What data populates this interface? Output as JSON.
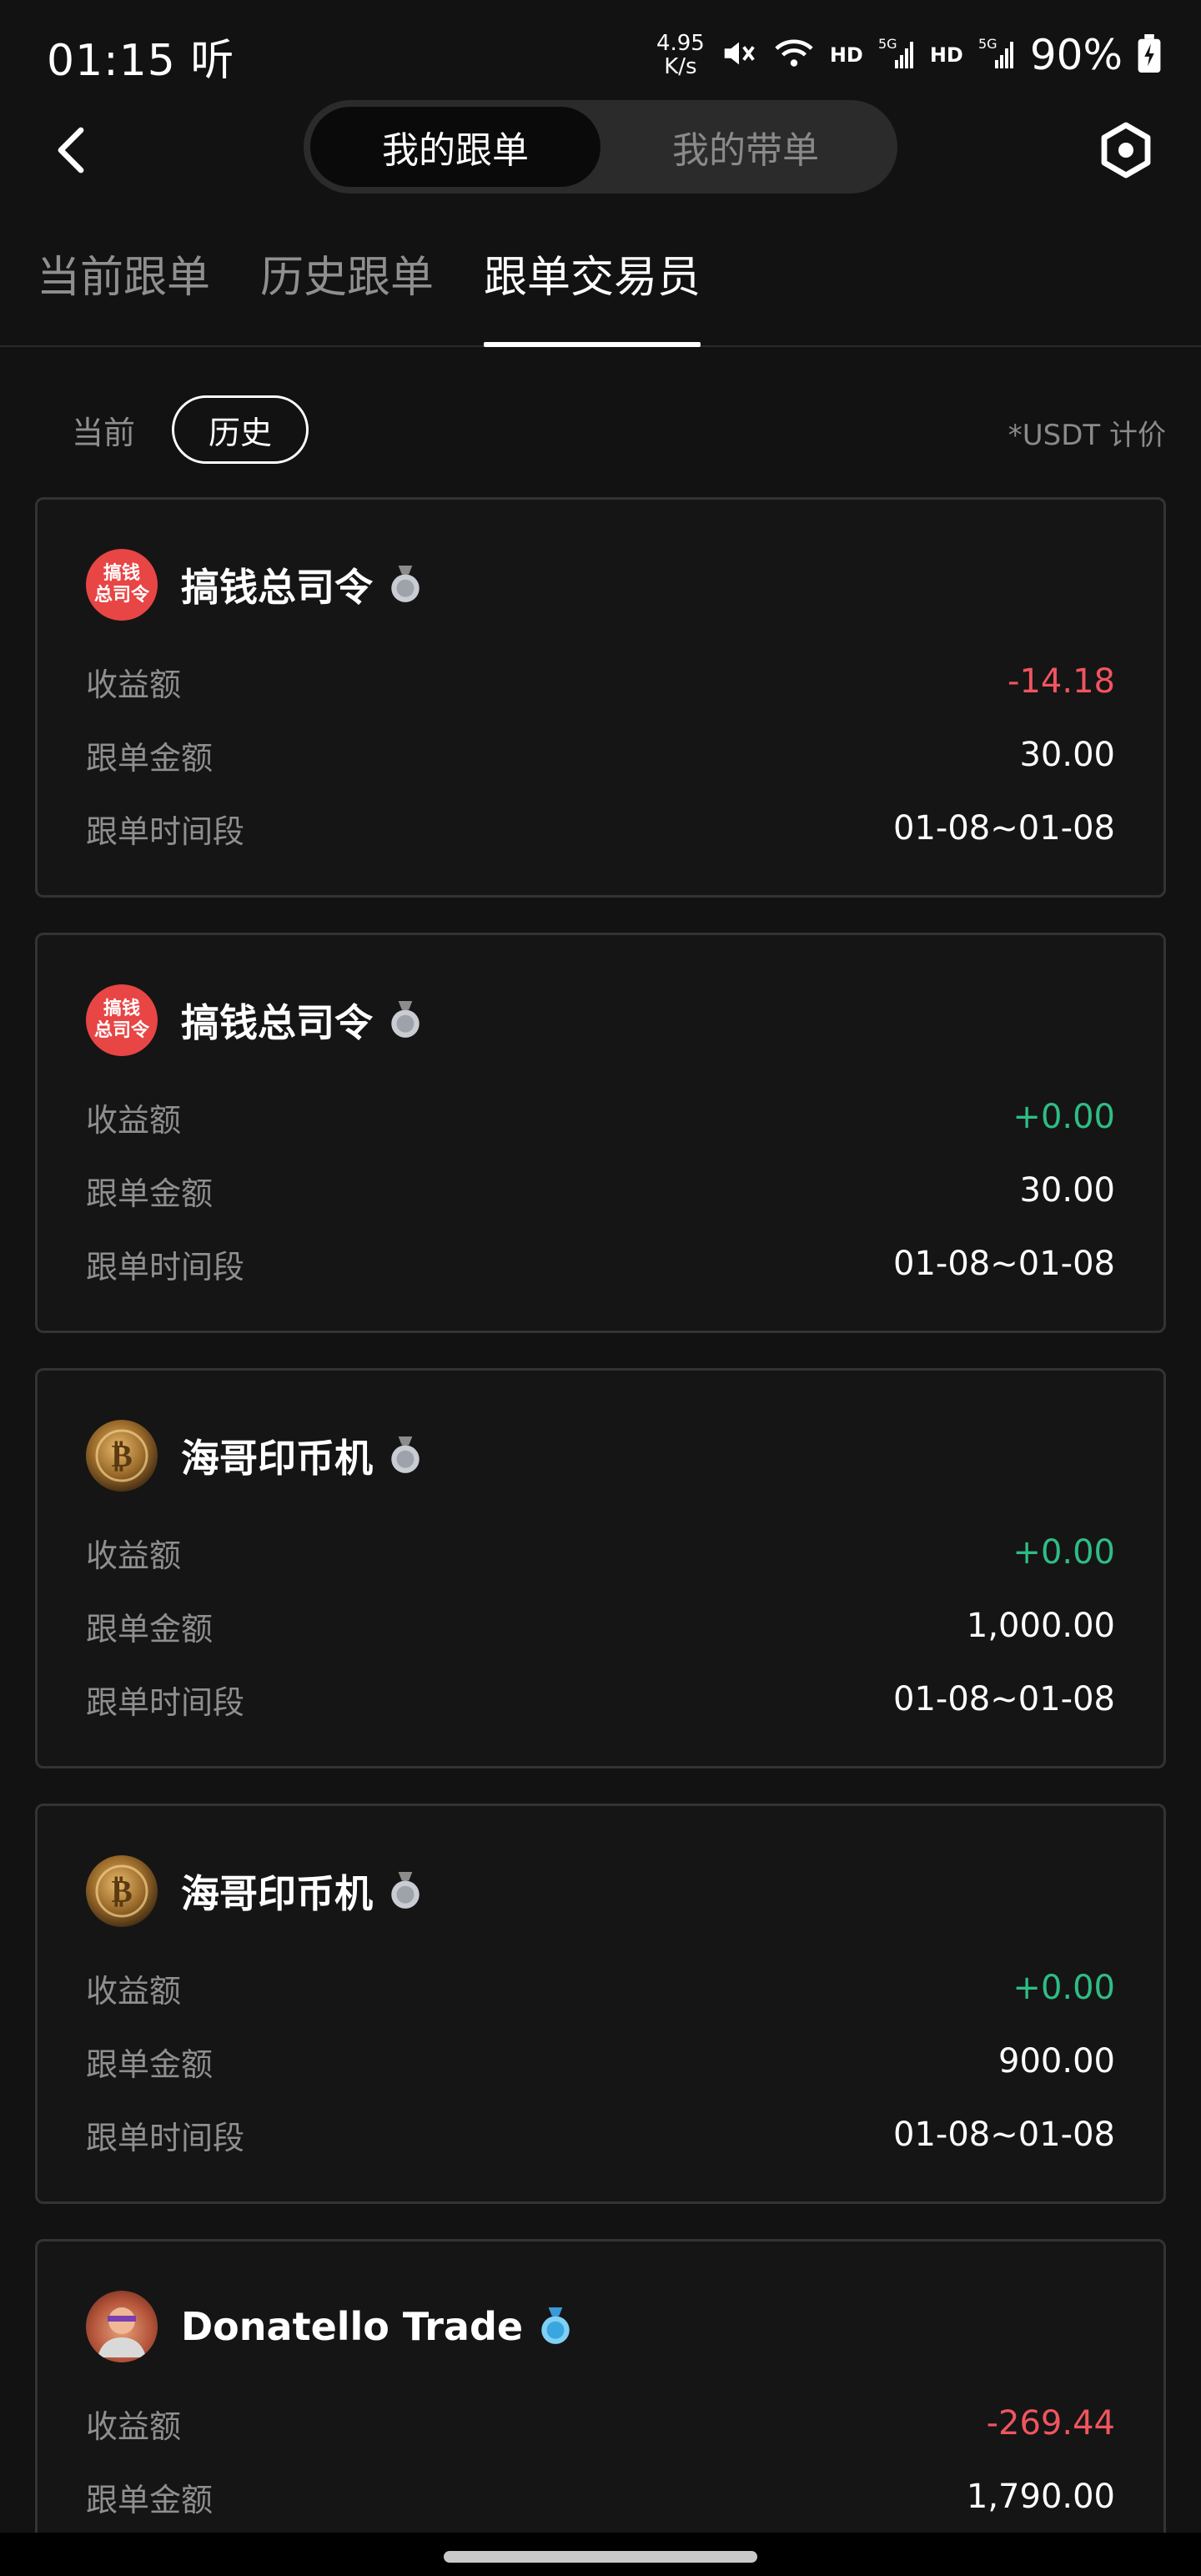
{
  "status_bar": {
    "time": "01:15",
    "time_suffix": "听",
    "net_speed_value": "4.95",
    "net_speed_unit": "K/s",
    "hd_1": "HD",
    "hd_2": "HD",
    "battery": "90%"
  },
  "header": {
    "segments": [
      "我的跟单",
      "我的带单"
    ],
    "active_segment": 0
  },
  "tabs": {
    "items": [
      "当前跟单",
      "历史跟单",
      "跟单交易员"
    ],
    "active": 2
  },
  "filters": {
    "current": "当前",
    "history": "历史",
    "currency_note": "*USDT 计价"
  },
  "labels": {
    "pnl": "收益额",
    "amount": "跟单金额",
    "period": "跟单时间段"
  },
  "cards": [
    {
      "name": "搞钱总司令",
      "avatar_text_1": "搞钱",
      "avatar_text_2": "总司令",
      "avatar_style": "red",
      "medal": "silver",
      "pnl": "-14.18",
      "pnl_sign": "neg",
      "amount": "30.00",
      "period": "01-08~01-08"
    },
    {
      "name": "搞钱总司令",
      "avatar_text_1": "搞钱",
      "avatar_text_2": "总司令",
      "avatar_style": "red",
      "medal": "silver",
      "pnl": "+0.00",
      "pnl_sign": "pos",
      "amount": "30.00",
      "period": "01-08~01-08"
    },
    {
      "name": "海哥印币机",
      "avatar_style": "coin",
      "medal": "silver",
      "pnl": "+0.00",
      "pnl_sign": "pos",
      "amount": "1,000.00",
      "period": "01-08~01-08"
    },
    {
      "name": "海哥印币机",
      "avatar_style": "coin",
      "medal": "silver",
      "pnl": "+0.00",
      "pnl_sign": "pos",
      "amount": "900.00",
      "period": "01-08~01-08"
    },
    {
      "name": "Donatello Trade",
      "avatar_style": "person",
      "medal": "diamond",
      "pnl": "-269.44",
      "pnl_sign": "neg",
      "amount": "1,790.00",
      "period": ""
    }
  ],
  "colors": {
    "background": "#121212",
    "negative": "#f0555f",
    "positive": "#2fbd85",
    "card_border": "#333333"
  }
}
